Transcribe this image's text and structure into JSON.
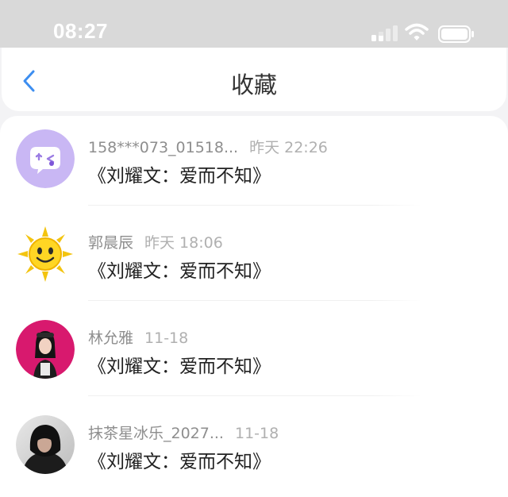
{
  "status_bar": {
    "time": "08:27",
    "icons": [
      "signal-icon",
      "wifi-icon",
      "battery-icon"
    ]
  },
  "nav": {
    "back_icon": "chevron-left-icon",
    "title": "收藏"
  },
  "favorites": [
    {
      "avatar": "chat-bubble-avatar",
      "user": "158***073_01518...",
      "time": "昨天 22:26",
      "title": "《刘耀文：爱而不知》"
    },
    {
      "avatar": "sun-avatar",
      "user": "郭晨辰",
      "time": "昨天 18:06",
      "title": "《刘耀文：爱而不知》"
    },
    {
      "avatar": "girl-photo-avatar",
      "user": "林允雅",
      "time": "11-18",
      "title": "《刘耀文：爱而不知》"
    },
    {
      "avatar": "hooded-person-avatar",
      "user": "抹茶星冰乐_2027...",
      "time": "11-18",
      "title": "《刘耀文：爱而不知》"
    }
  ],
  "colors": {
    "accent": "#3d8ef0",
    "status_bar_bg": "#d9d9d9",
    "page_bg": "#f3f3f5",
    "meta_text": "#9a9a9a",
    "title_text": "#222222"
  }
}
